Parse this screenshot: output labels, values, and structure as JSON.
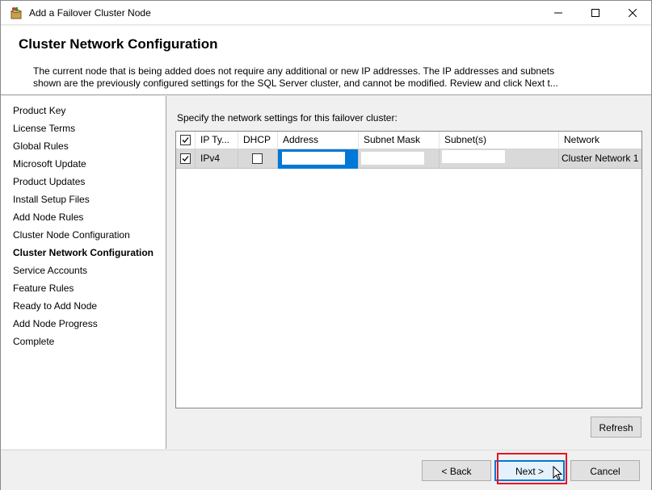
{
  "window": {
    "title": "Add a Failover Cluster Node",
    "controls": {
      "minimize": "—",
      "maximize": "☐",
      "close": "✕"
    }
  },
  "header": {
    "title": "Cluster Network Configuration",
    "description_line1": "The current node that is being added does not require any additional or new IP addresses.  The IP addresses and subnets",
    "description_line2": "shown are the previously configured settings for the SQL Server cluster, and cannot be modified. Review and click Next t..."
  },
  "steps": [
    {
      "label": "Product Key",
      "active": false
    },
    {
      "label": "License Terms",
      "active": false
    },
    {
      "label": "Global Rules",
      "active": false
    },
    {
      "label": "Microsoft Update",
      "active": false
    },
    {
      "label": "Product Updates",
      "active": false
    },
    {
      "label": "Install Setup Files",
      "active": false
    },
    {
      "label": "Add Node Rules",
      "active": false
    },
    {
      "label": "Cluster Node Configuration",
      "active": false
    },
    {
      "label": "Cluster Network Configuration",
      "active": true
    },
    {
      "label": "Service Accounts",
      "active": false
    },
    {
      "label": "Feature Rules",
      "active": false
    },
    {
      "label": "Ready to Add Node",
      "active": false
    },
    {
      "label": "Add Node Progress",
      "active": false
    },
    {
      "label": "Complete",
      "active": false
    }
  ],
  "main": {
    "instruction": "Specify the network settings for this failover cluster:",
    "grid": {
      "columns": [
        "IP Ty...",
        "DHCP",
        "Address",
        "Subnet Mask",
        "Subnet(s)",
        "Network"
      ],
      "header_checked": true,
      "rows": [
        {
          "checked": true,
          "ip_type": "IPv4",
          "dhcp": false,
          "address": "",
          "subnet_mask": "",
          "subnets": "",
          "network": "Cluster Network 1"
        }
      ]
    },
    "refresh_label": "Refresh"
  },
  "footer": {
    "back_label": "< Back",
    "next_label": "Next >",
    "cancel_label": "Cancel"
  },
  "colors": {
    "accent": "#0078d7",
    "highlight": "#e81123"
  }
}
